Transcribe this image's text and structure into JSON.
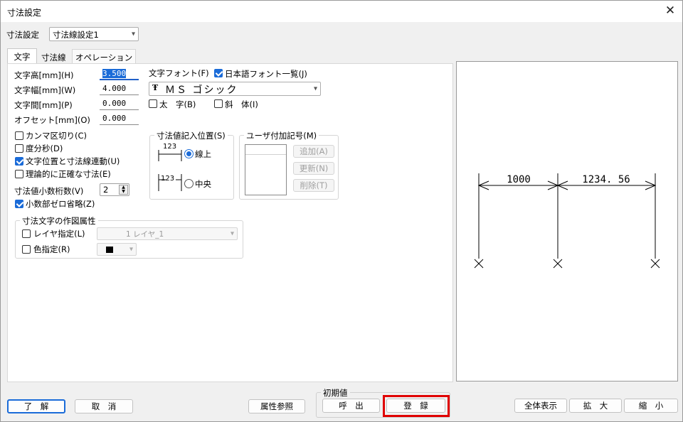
{
  "window": {
    "title": "寸法設定",
    "close_symbol": "✕"
  },
  "settings_row": {
    "label": "寸法設定",
    "selected": "寸法線設定1"
  },
  "tabs": [
    "文字",
    "寸法線",
    "オペレーション"
  ],
  "fields": [
    {
      "label": "文字高[mm](H)",
      "value": "3.500"
    },
    {
      "label": "文字幅[mm](W)",
      "value": "4.000"
    },
    {
      "label": "文字間[mm](P)",
      "value": "0.000"
    },
    {
      "label": "オフセット[mm](O)",
      "value": "0.000"
    }
  ],
  "font": {
    "label": "文字フォント(F)",
    "jp_list_label": "日本語フォント一覧(J)",
    "jp_list_checked": true,
    "icon_glyph": "Ŧ",
    "selected": "ＭＳ ゴシック",
    "bold_label": "太　字(B)",
    "italic_label": "斜　体(I)"
  },
  "options": [
    {
      "label": "カンマ区切り(C)",
      "checked": false
    },
    {
      "label": "度分秒(D)",
      "checked": false
    },
    {
      "label": "文字位置と寸法線連動(U)",
      "checked": true
    },
    {
      "label": "理論的に正確な寸法(E)",
      "checked": false
    }
  ],
  "decimals": {
    "label": "寸法値小数桁数(V)",
    "value": "2"
  },
  "zero_omit": {
    "label": "小数部ゼロ省略(Z)",
    "checked": true
  },
  "position_group": {
    "label": "寸法値記入位置(S)",
    "sample": "123",
    "options": [
      {
        "label": "線上",
        "selected": true
      },
      {
        "label": "中央",
        "selected": false
      }
    ]
  },
  "user_symbol_group": {
    "label": "ユーザ付加記号(M)",
    "buttons": [
      "追加(A)",
      "更新(N)",
      "削除(T)"
    ]
  },
  "draw_attr_group": {
    "label": "寸法文字の作図属性",
    "layer_label": "レイヤ指定(L)",
    "layer_value": "1 レイヤ_1",
    "color_label": "色指定(R)",
    "color_value": "#000000"
  },
  "preview": {
    "dim1": "1000",
    "dim2": "1234. 56"
  },
  "buttons": {
    "ok": "了　解",
    "cancel": "取　消",
    "attr_ref": "属性参照",
    "initial_group": "初期値",
    "call": "呼　出",
    "register": "登　録",
    "fit_all": "全体表示",
    "zoom_in": "拡　大",
    "zoom_out": "縮　小"
  },
  "colors": {
    "accent": "#1a6bd8",
    "highlight": "#e00000"
  },
  "icons": {
    "chevron": "▾",
    "spin_up": "▲",
    "spin_down": "▼"
  }
}
